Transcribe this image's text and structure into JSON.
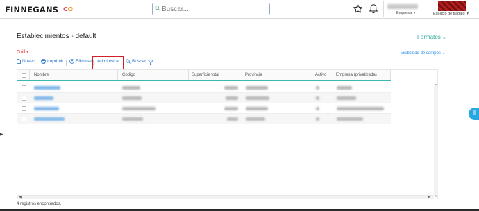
{
  "app": {
    "logo_text": "FINNEGANS",
    "logo_mark": [
      "c",
      "o"
    ],
    "search_placeholder": "Buscar...",
    "empresa_label": "Empresa",
    "espacio_label": "Espacio de trabajo"
  },
  "page": {
    "title": "Establecimientos - default",
    "formatos": "Formatos",
    "grilla": "Grilla",
    "visibilidad": "Visibilidad de campos"
  },
  "toolbar": {
    "nuevo": "Nuevo",
    "imprimir": "Imprimir",
    "eliminar": "Eliminar",
    "administrar": "Administrar",
    "buscar": "Buscar"
  },
  "grid": {
    "columns": [
      "Nombre",
      "Codigo",
      "Superficie total",
      "Provincia",
      "Activo",
      "Empresa (privatizada)"
    ],
    "row_count": 4
  },
  "footer": {
    "records": "4 registros encontrados."
  },
  "colors": {
    "accent_teal": "#2ea79a",
    "link_blue": "#1e6fc8",
    "highlight_red": "#d32027",
    "grilla_red": "#e53935",
    "fab_blue": "#29a7e0"
  }
}
